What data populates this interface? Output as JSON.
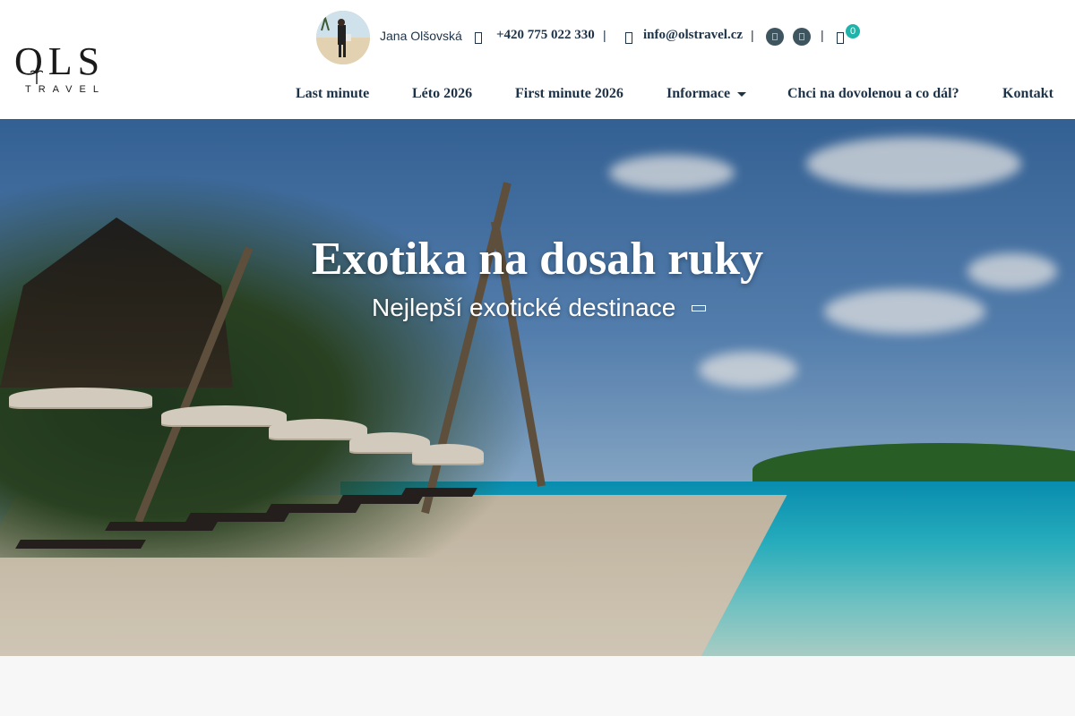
{
  "brand": {
    "logo_main": "OLS",
    "logo_sub": "TRAVEL"
  },
  "topbar": {
    "owner_name": "Jana Olšovská",
    "phone": "+420 775 022 330",
    "email": "info@olstravel.cz",
    "separator": "|",
    "cart_count": "0",
    "icons": [
      "phone-icon",
      "mail-icon",
      "facebook-icon",
      "instagram-icon",
      "cart-icon"
    ]
  },
  "nav": {
    "items": [
      {
        "label": "Last minute"
      },
      {
        "label": "Léto 2026"
      },
      {
        "label": "First minute 2026"
      },
      {
        "label": "Informace",
        "has_dropdown": true
      },
      {
        "label": "Chci na dovolenou a co dál?"
      },
      {
        "label": "Kontakt"
      }
    ]
  },
  "hero": {
    "title": "Exotika na dosah ruky",
    "subtitle": "Nejlepší exotické destinace"
  },
  "colors": {
    "text": "#1e3247",
    "badge": "#1fb3a9",
    "social": "#3e5560",
    "header_bg": "#ffffff",
    "page_bg": "#f7f7f7"
  }
}
